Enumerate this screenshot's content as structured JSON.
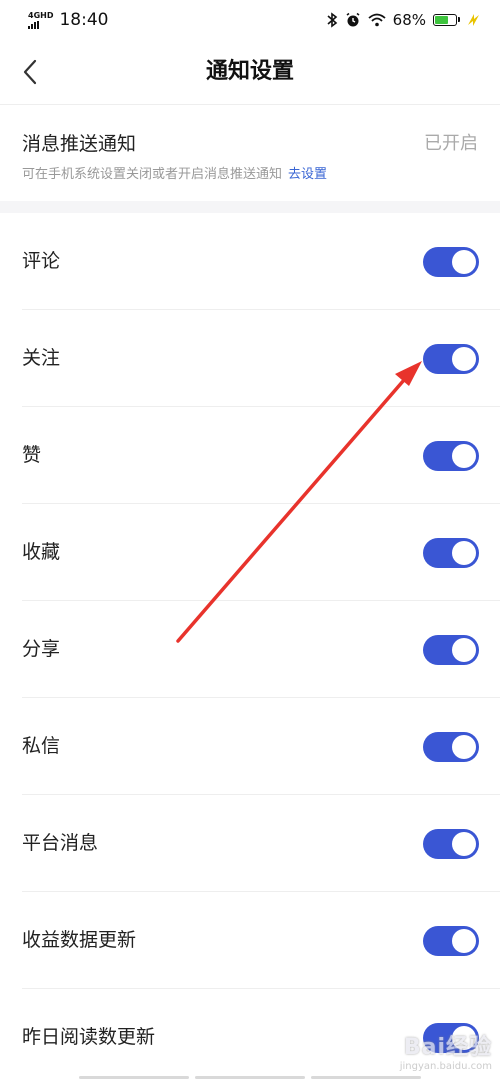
{
  "status_bar": {
    "network": "4GHD",
    "time": "18:40",
    "battery_percent": "68%",
    "battery_level": 0.68
  },
  "nav": {
    "back_icon": "chevron-left-icon",
    "title": "通知设置"
  },
  "push": {
    "title": "消息推送通知",
    "status": "已开启",
    "description": "可在手机系统设置关闭或者开启消息推送通知",
    "link": "去设置"
  },
  "settings": [
    {
      "label": "评论",
      "enabled": true
    },
    {
      "label": "关注",
      "enabled": true
    },
    {
      "label": "赞",
      "enabled": true
    },
    {
      "label": "收藏",
      "enabled": true
    },
    {
      "label": "分享",
      "enabled": true
    },
    {
      "label": "私信",
      "enabled": true
    },
    {
      "label": "平台消息",
      "enabled": true
    },
    {
      "label": "收益数据更新",
      "enabled": true
    },
    {
      "label": "昨日阅读数更新",
      "enabled": true
    }
  ],
  "colors": {
    "toggle_on": "#3a56d4",
    "link": "#3a66d4",
    "annotation_arrow": "#e8332c",
    "battery": "#3ec43e"
  },
  "watermark": {
    "main": "Bai经验",
    "sub": "jingyan.baidu.com"
  }
}
